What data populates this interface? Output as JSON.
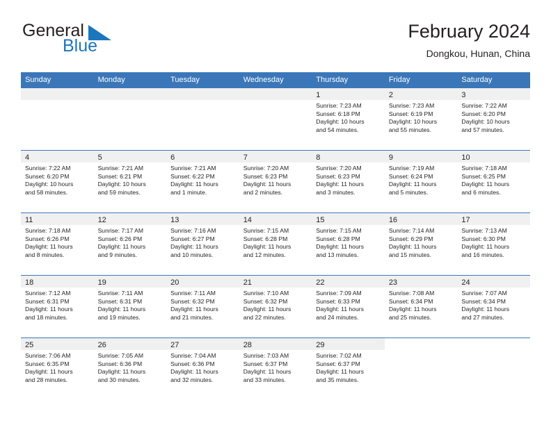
{
  "brand": {
    "name_part1": "General",
    "name_part2": "Blue",
    "accent_color": "#1c76bc"
  },
  "header": {
    "title": "February 2024",
    "subtitle": "Dongkou, Hunan, China"
  },
  "theme": {
    "header_row_color": "#3b77b8",
    "day_band_color": "#f0f0f0",
    "text_color": "#231f20"
  },
  "weekday_headers": [
    "Sunday",
    "Monday",
    "Tuesday",
    "Wednesday",
    "Thursday",
    "Friday",
    "Saturday"
  ],
  "weeks": [
    [
      {
        "day": "",
        "empty": true
      },
      {
        "day": "",
        "empty": true
      },
      {
        "day": "",
        "empty": true
      },
      {
        "day": "",
        "empty": true
      },
      {
        "day": "1",
        "sunrise": "Sunrise: 7:23 AM",
        "sunset": "Sunset: 6:18 PM",
        "daylight_line1": "Daylight: 10 hours",
        "daylight_line2": "and 54 minutes."
      },
      {
        "day": "2",
        "sunrise": "Sunrise: 7:23 AM",
        "sunset": "Sunset: 6:19 PM",
        "daylight_line1": "Daylight: 10 hours",
        "daylight_line2": "and 55 minutes."
      },
      {
        "day": "3",
        "sunrise": "Sunrise: 7:22 AM",
        "sunset": "Sunset: 6:20 PM",
        "daylight_line1": "Daylight: 10 hours",
        "daylight_line2": "and 57 minutes."
      }
    ],
    [
      {
        "day": "4",
        "sunrise": "Sunrise: 7:22 AM",
        "sunset": "Sunset: 6:20 PM",
        "daylight_line1": "Daylight: 10 hours",
        "daylight_line2": "and 58 minutes."
      },
      {
        "day": "5",
        "sunrise": "Sunrise: 7:21 AM",
        "sunset": "Sunset: 6:21 PM",
        "daylight_line1": "Daylight: 10 hours",
        "daylight_line2": "and 59 minutes."
      },
      {
        "day": "6",
        "sunrise": "Sunrise: 7:21 AM",
        "sunset": "Sunset: 6:22 PM",
        "daylight_line1": "Daylight: 11 hours",
        "daylight_line2": "and 1 minute."
      },
      {
        "day": "7",
        "sunrise": "Sunrise: 7:20 AM",
        "sunset": "Sunset: 6:23 PM",
        "daylight_line1": "Daylight: 11 hours",
        "daylight_line2": "and 2 minutes."
      },
      {
        "day": "8",
        "sunrise": "Sunrise: 7:20 AM",
        "sunset": "Sunset: 6:23 PM",
        "daylight_line1": "Daylight: 11 hours",
        "daylight_line2": "and 3 minutes."
      },
      {
        "day": "9",
        "sunrise": "Sunrise: 7:19 AM",
        "sunset": "Sunset: 6:24 PM",
        "daylight_line1": "Daylight: 11 hours",
        "daylight_line2": "and 5 minutes."
      },
      {
        "day": "10",
        "sunrise": "Sunrise: 7:18 AM",
        "sunset": "Sunset: 6:25 PM",
        "daylight_line1": "Daylight: 11 hours",
        "daylight_line2": "and 6 minutes."
      }
    ],
    [
      {
        "day": "11",
        "sunrise": "Sunrise: 7:18 AM",
        "sunset": "Sunset: 6:26 PM",
        "daylight_line1": "Daylight: 11 hours",
        "daylight_line2": "and 8 minutes."
      },
      {
        "day": "12",
        "sunrise": "Sunrise: 7:17 AM",
        "sunset": "Sunset: 6:26 PM",
        "daylight_line1": "Daylight: 11 hours",
        "daylight_line2": "and 9 minutes."
      },
      {
        "day": "13",
        "sunrise": "Sunrise: 7:16 AM",
        "sunset": "Sunset: 6:27 PM",
        "daylight_line1": "Daylight: 11 hours",
        "daylight_line2": "and 10 minutes."
      },
      {
        "day": "14",
        "sunrise": "Sunrise: 7:15 AM",
        "sunset": "Sunset: 6:28 PM",
        "daylight_line1": "Daylight: 11 hours",
        "daylight_line2": "and 12 minutes."
      },
      {
        "day": "15",
        "sunrise": "Sunrise: 7:15 AM",
        "sunset": "Sunset: 6:28 PM",
        "daylight_line1": "Daylight: 11 hours",
        "daylight_line2": "and 13 minutes."
      },
      {
        "day": "16",
        "sunrise": "Sunrise: 7:14 AM",
        "sunset": "Sunset: 6:29 PM",
        "daylight_line1": "Daylight: 11 hours",
        "daylight_line2": "and 15 minutes."
      },
      {
        "day": "17",
        "sunrise": "Sunrise: 7:13 AM",
        "sunset": "Sunset: 6:30 PM",
        "daylight_line1": "Daylight: 11 hours",
        "daylight_line2": "and 16 minutes."
      }
    ],
    [
      {
        "day": "18",
        "sunrise": "Sunrise: 7:12 AM",
        "sunset": "Sunset: 6:31 PM",
        "daylight_line1": "Daylight: 11 hours",
        "daylight_line2": "and 18 minutes."
      },
      {
        "day": "19",
        "sunrise": "Sunrise: 7:11 AM",
        "sunset": "Sunset: 6:31 PM",
        "daylight_line1": "Daylight: 11 hours",
        "daylight_line2": "and 19 minutes."
      },
      {
        "day": "20",
        "sunrise": "Sunrise: 7:11 AM",
        "sunset": "Sunset: 6:32 PM",
        "daylight_line1": "Daylight: 11 hours",
        "daylight_line2": "and 21 minutes."
      },
      {
        "day": "21",
        "sunrise": "Sunrise: 7:10 AM",
        "sunset": "Sunset: 6:32 PM",
        "daylight_line1": "Daylight: 11 hours",
        "daylight_line2": "and 22 minutes."
      },
      {
        "day": "22",
        "sunrise": "Sunrise: 7:09 AM",
        "sunset": "Sunset: 6:33 PM",
        "daylight_line1": "Daylight: 11 hours",
        "daylight_line2": "and 24 minutes."
      },
      {
        "day": "23",
        "sunrise": "Sunrise: 7:08 AM",
        "sunset": "Sunset: 6:34 PM",
        "daylight_line1": "Daylight: 11 hours",
        "daylight_line2": "and 25 minutes."
      },
      {
        "day": "24",
        "sunrise": "Sunrise: 7:07 AM",
        "sunset": "Sunset: 6:34 PM",
        "daylight_line1": "Daylight: 11 hours",
        "daylight_line2": "and 27 minutes."
      }
    ],
    [
      {
        "day": "25",
        "sunrise": "Sunrise: 7:06 AM",
        "sunset": "Sunset: 6:35 PM",
        "daylight_line1": "Daylight: 11 hours",
        "daylight_line2": "and 28 minutes."
      },
      {
        "day": "26",
        "sunrise": "Sunrise: 7:05 AM",
        "sunset": "Sunset: 6:36 PM",
        "daylight_line1": "Daylight: 11 hours",
        "daylight_line2": "and 30 minutes."
      },
      {
        "day": "27",
        "sunrise": "Sunrise: 7:04 AM",
        "sunset": "Sunset: 6:36 PM",
        "daylight_line1": "Daylight: 11 hours",
        "daylight_line2": "and 32 minutes."
      },
      {
        "day": "28",
        "sunrise": "Sunrise: 7:03 AM",
        "sunset": "Sunset: 6:37 PM",
        "daylight_line1": "Daylight: 11 hours",
        "daylight_line2": "and 33 minutes."
      },
      {
        "day": "29",
        "sunrise": "Sunrise: 7:02 AM",
        "sunset": "Sunset: 6:37 PM",
        "daylight_line1": "Daylight: 11 hours",
        "daylight_line2": "and 35 minutes."
      },
      {
        "day": "",
        "empty": true,
        "blank_cell": true
      },
      {
        "day": "",
        "empty": true,
        "blank_cell": true
      }
    ]
  ]
}
